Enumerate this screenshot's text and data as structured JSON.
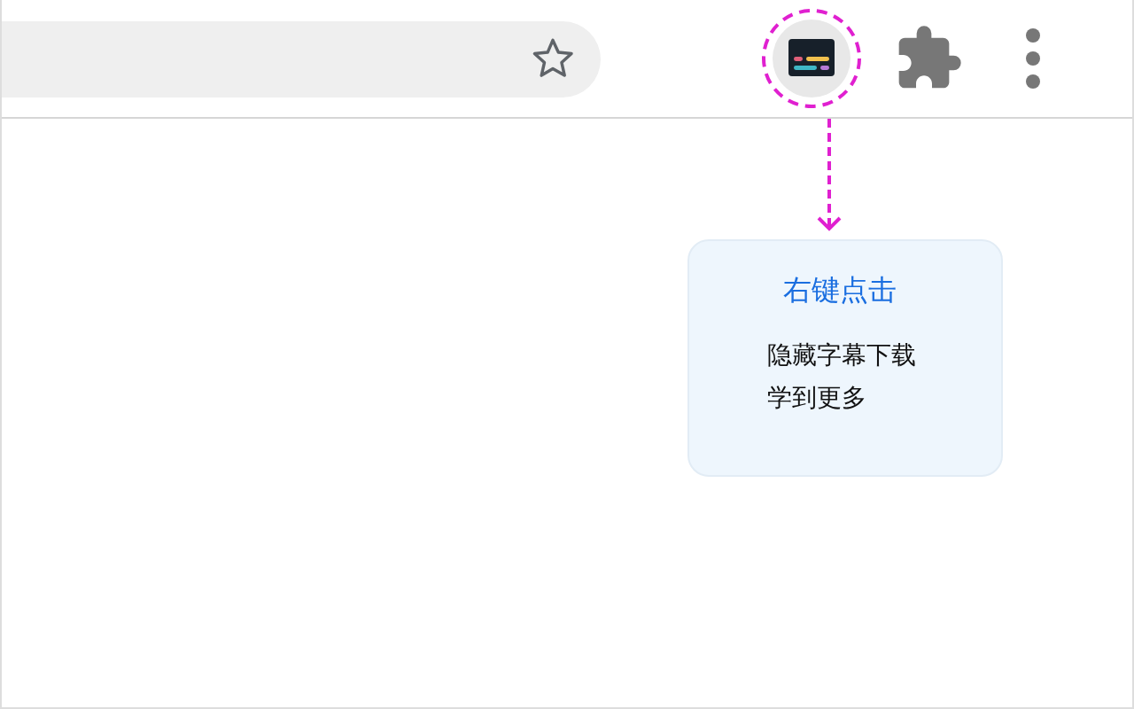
{
  "context_menu": {
    "title": "右键点击",
    "items": [
      "隐藏字幕下载",
      "学到更多"
    ]
  }
}
